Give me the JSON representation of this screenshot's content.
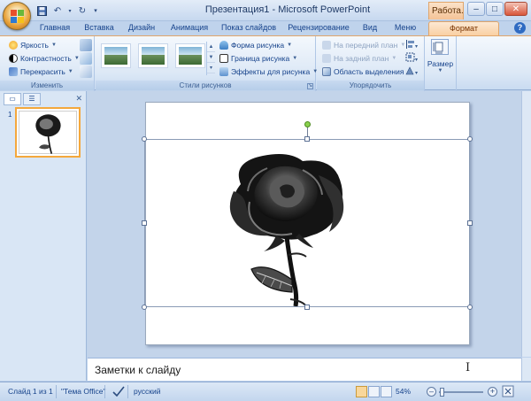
{
  "app": {
    "title": "Презентация1 - Microsoft PowerPoint",
    "context_tab_title": "Работа..."
  },
  "tabs": [
    {
      "label": "Главная"
    },
    {
      "label": "Вставка"
    },
    {
      "label": "Дизайн"
    },
    {
      "label": "Анимация"
    },
    {
      "label": "Показ слайдов"
    },
    {
      "label": "Рецензирование"
    },
    {
      "label": "Вид"
    },
    {
      "label": "Меню"
    },
    {
      "label": "Формат"
    }
  ],
  "ribbon": {
    "adjust": {
      "label": "Изменить",
      "brightness": "Яркость",
      "contrast": "Контрастность",
      "recolor": "Перекрасить"
    },
    "styles": {
      "label": "Стили рисунков",
      "shape": "Форма рисунка",
      "border": "Граница рисунка",
      "effects": "Эффекты для рисунка"
    },
    "arrange": {
      "label": "Упорядочить",
      "bring_front": "На передний план",
      "send_back": "На задний план",
      "selection_pane": "Область выделения"
    },
    "size": {
      "label": "Размер"
    }
  },
  "left_pane": {
    "slide_number": "1"
  },
  "notes": {
    "placeholder": "Заметки к слайду"
  },
  "status": {
    "slide": "Слайд 1 из 1",
    "theme": "\"Тема Office\"",
    "language": "русский",
    "zoom": "54%",
    "zoom_level": 0.54
  },
  "colors": {
    "accent": "#f4a83c",
    "ribbon_bg": "#dce8f6",
    "context_tab": "#f9d0a3"
  }
}
